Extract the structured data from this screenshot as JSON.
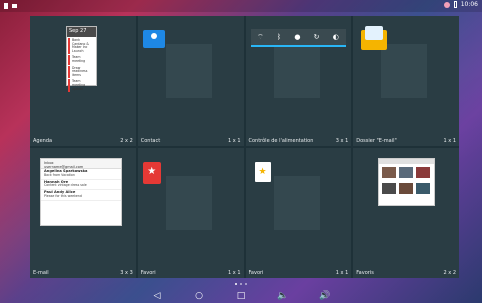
{
  "status_bar": {
    "time": "10:06"
  },
  "widgets": [
    {
      "label": "Agenda",
      "size": "2 x 2"
    },
    {
      "label": "Contact",
      "size": "1 x 1"
    },
    {
      "label": "Contrôle de l'alimentation",
      "size": "3 x 1"
    },
    {
      "label": "Dossier \"E-mail\"",
      "size": "1 x 1"
    },
    {
      "label": "E-mail",
      "size": "3 x 3"
    },
    {
      "label": "Favori",
      "size": "1 x 1"
    },
    {
      "label": "Favori",
      "size": "1 x 1"
    },
    {
      "label": "Favoris",
      "size": "2 x 2"
    }
  ],
  "agenda_preview": {
    "date": "Sep 27",
    "items": [
      "Bank Cardano & Maker Inc Launch",
      "Team meeting",
      "Draw readiness items",
      "Team meeting update"
    ]
  },
  "email_preview": {
    "account": "Inbox",
    "address": "username@gmail.com",
    "messages": [
      {
        "sender": "Angelina Sparkowska",
        "subject": "Back from Vacation"
      },
      {
        "sender": "Hannah Ore",
        "subject": "Content vintage dress sale"
      },
      {
        "sender": "Paul Andy Alice",
        "subject": "Please for this weekend"
      }
    ]
  },
  "navigation": {
    "back_icon": "◁",
    "home_icon": "○",
    "recents_icon": "□",
    "vol_down_icon": "🔈",
    "vol_up_icon": "🔊"
  }
}
